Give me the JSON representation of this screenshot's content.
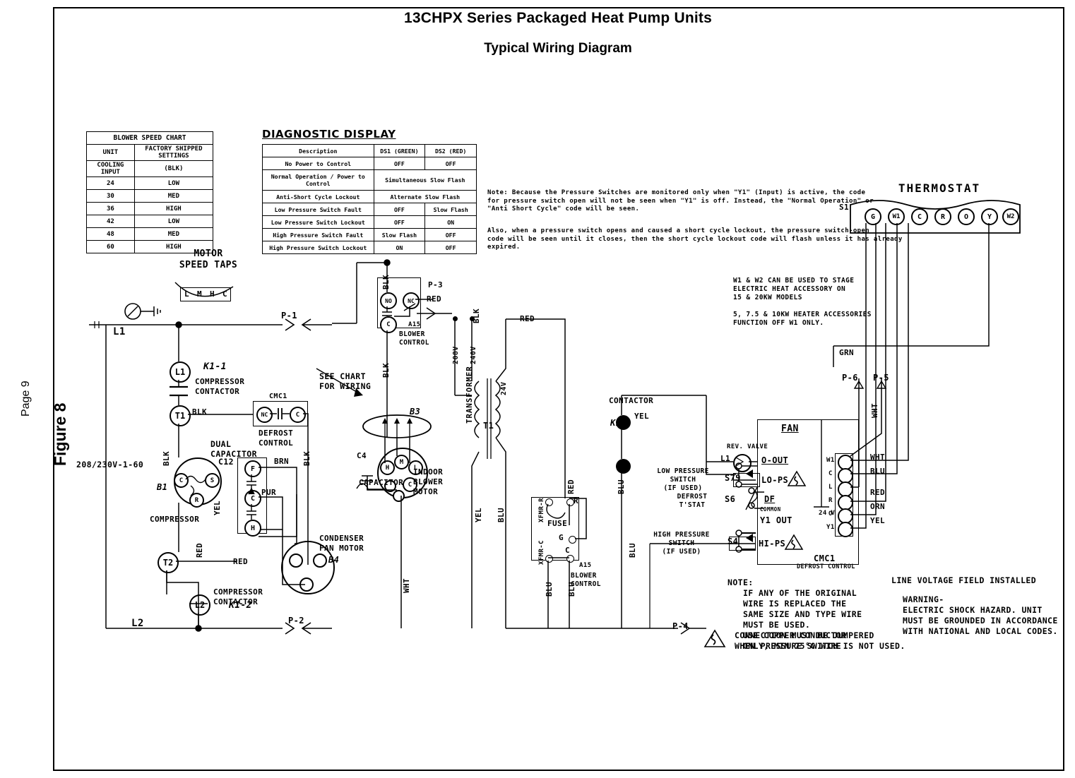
{
  "document": {
    "title": "13CHPX Series Packaged Heat Pump Units",
    "subtitle": "Typical Wiring Diagram",
    "figure_label": "Figure 8",
    "page_label": "Page 9"
  },
  "blower_speed_chart": {
    "title": "BLOWER SPEED CHART",
    "headers": [
      "UNIT",
      "FACTORY SHIPPED SETTINGS"
    ],
    "subheaders": [
      "COOLING INPUT",
      "(BLK)"
    ],
    "rows": [
      [
        "24",
        "LOW"
      ],
      [
        "30",
        "MED"
      ],
      [
        "36",
        "HIGH"
      ],
      [
        "42",
        "LOW"
      ],
      [
        "48",
        "MED"
      ],
      [
        "60",
        "HIGH"
      ]
    ]
  },
  "diagnostic_display": {
    "title": "DIAGNOSTIC DISPLAY",
    "headers": [
      "Description",
      "DS1 (GREEN)",
      "DS2 (RED)"
    ],
    "rows": [
      {
        "desc": "No Power to Control",
        "ds1": "OFF",
        "ds2": "OFF",
        "span": false
      },
      {
        "desc": "Normal Operation / Power to Control",
        "ds1": "Simultaneous Slow Flash",
        "ds2": "",
        "span": true
      },
      {
        "desc": "Anti-Short Cycle Lockout",
        "ds1": "Alternate Slow Flash",
        "ds2": "",
        "span": true
      },
      {
        "desc": "Low Pressure Switch Fault",
        "ds1": "OFF",
        "ds2": "Slow Flash",
        "span": false
      },
      {
        "desc": "Low Pressure Switch Lockout",
        "ds1": "OFF",
        "ds2": "ON",
        "span": false
      },
      {
        "desc": "High Pressure Switch Fault",
        "ds1": "Slow Flash",
        "ds2": "OFF",
        "span": false
      },
      {
        "desc": "High Pressure Switch Lockout",
        "ds1": "ON",
        "ds2": "OFF",
        "span": false
      }
    ]
  },
  "notes": {
    "pressure_switch_note": "Note: Because the Pressure Switches are monitored only when \"Y1\" (Input) is active, the code\nfor pressure switch open will not be seen when \"Y1\" is off. Instead, the \"Normal Operation\" or\n\"Anti Short Cycle\" code will be seen.",
    "short_cycle_note": "Also, when a pressure switch opens and caused a short cycle lockout, the pressure switch-open\ncode will be seen until it closes, then the short cycle lockout code will flash unless it has already\nexpired.",
    "stage_note": "W1 & W2 CAN BE USED TO STAGE\nELECTRIC HEAT ACCESSORY ON\n15 & 20KW MODELS",
    "heater_note": "5, 7.5 & 10KW HEATER ACCESSORIES\nFUNCTION OFF W1 ONLY.",
    "wire_note": "NOTE:\n   IF ANY OF THE ORIGINAL\n   WIRE IS REPLACED THE\n   SAME SIZE AND TYPE WIRE\n   MUST BE USED.\n   USE COPPER CONDUCTOR\n   ONLY, MIN 75°C WIRE",
    "jumper_note": "CONNECTION MUST BE JUMPERED\nWHEN PRESSURE SWITCH IS NOT USED.",
    "line_voltage_note": "LINE VOLTAGE FIELD INSTALLED",
    "warning": "WARNING-\nELECTRIC SHOCK HAZARD. UNIT\nMUST BE GROUNDED IN ACCORDANCE\nWITH NATIONAL AND LOCAL CODES.",
    "see_chart": "SEE CHART\nFOR WIRING"
  },
  "thermostat": {
    "title": "THERMOSTAT",
    "designator": "S1",
    "terminals": [
      "G",
      "W1",
      "C",
      "R",
      "O",
      "Y",
      "W2"
    ]
  },
  "power": {
    "supply_label": "208/230V-1-60",
    "l1": "L1",
    "l2": "L2"
  },
  "motor_speed_taps": {
    "label": "MOTOR\nSPEED TAPS",
    "taps": [
      "L",
      "M",
      "H",
      "C"
    ]
  },
  "compressor_section": {
    "k1_1": "K1-1",
    "k1_2": "K1-2",
    "contactor_label": "COMPRESSOR\nCONTACTOR",
    "l1_node": "L1",
    "t1_node": "T1",
    "t2_node": "T2",
    "l2_node": "L2",
    "compressor_label": "COMPRESSOR",
    "compressor_designator": "B1",
    "compressor_terminals": [
      "C",
      "S",
      "R"
    ],
    "dual_capacitor_label": "DUAL\nCAPACITOR",
    "dual_capacitor_designator": "C12",
    "cap_terminals": [
      "F",
      "C",
      "H"
    ],
    "defrost_control_label": "DEFROST\nCONTROL",
    "defrost_designator": "CMC1",
    "defrost_terminals": [
      "NC",
      "C"
    ],
    "condenser_fan_label": "CONDENSER\nFAN MOTOR",
    "condenser_fan_designator": "B4",
    "wire_colors": [
      "BLK",
      "BLK",
      "BLK",
      "BRN",
      "PUR",
      "YEL",
      "RED",
      "RED"
    ]
  },
  "blower_control_top": {
    "designator": "A15",
    "label": "BLOWER\nCONTROL",
    "terminals": [
      "NO",
      "NC",
      "C"
    ],
    "connector": "P-3",
    "wire": "RED"
  },
  "indoor_blower": {
    "designator": "B3",
    "label": "INDOOR\nBLOWER\nMOTOR",
    "taps": [
      "H",
      "M",
      "L",
      "C"
    ],
    "capacitor_label": "CAPACITOR",
    "capacitor_designator": "C4"
  },
  "transformer": {
    "label": "TRANSFORMER",
    "designator": "T1",
    "primary_taps": [
      "208V",
      "240V"
    ],
    "secondary": "24V",
    "wire_red": "RED",
    "wire_yel": "YEL",
    "wire_blu": "BLU"
  },
  "blower_control_bottom": {
    "designator": "A15",
    "label": "BLOWER\nCONTROL",
    "terminals": [
      "XFMR-R",
      "XFMR-C",
      "R",
      "G",
      "C"
    ],
    "fuse": "FUSE"
  },
  "contactor_coil": {
    "label": "CONTACTOR",
    "designator": "K1",
    "wire_yel": "YEL",
    "wire_blu": "BLU"
  },
  "switches": {
    "low_pressure": {
      "label": "LOW PRESSURE\nSWITCH\n(IF USED)",
      "designator": "S79"
    },
    "defrost_tstat": {
      "label": "DEFROST\nT'STAT",
      "designator": "S6"
    },
    "high_pressure": {
      "label": "HIGH PRESSURE\nSWITCH\n(IF USED)",
      "designator": "S4"
    }
  },
  "defrost_control_board": {
    "designator": "CMC1",
    "label": "DEFROST CONTROL",
    "rev_valve_label": "REV. VALVE",
    "rev_valve_designator": "L1",
    "inputs": [
      "FAN",
      "O-OUT",
      "LO-PS",
      "DF",
      "COMMON",
      "Y1 OUT",
      "HI-PS"
    ],
    "voltage": "24 V",
    "terminals": [
      "W1",
      "C",
      "L",
      "R",
      "O",
      "Y1"
    ],
    "terminal_wires": [
      "WHT",
      "BLU",
      "RED",
      "ORN",
      "YEL"
    ],
    "grn_wire": "GRN",
    "wht_wire": "WHT"
  },
  "connectors": [
    "P-1",
    "P-2",
    "P-3",
    "P-4",
    "P-5",
    "P-6"
  ]
}
